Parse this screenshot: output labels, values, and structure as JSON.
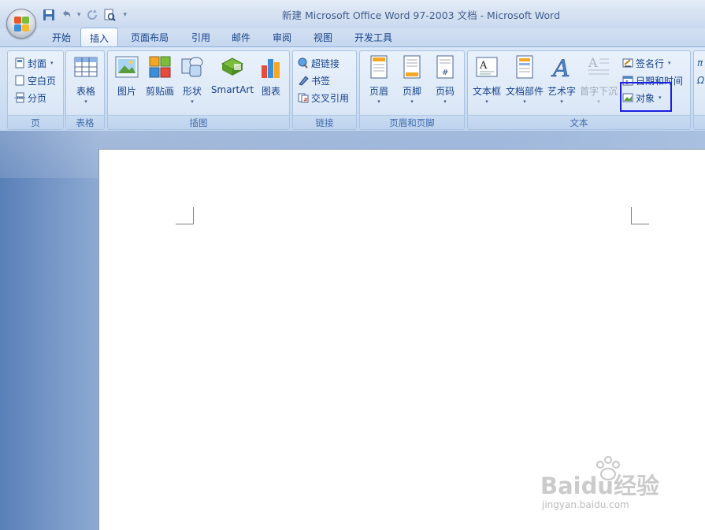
{
  "window": {
    "title": "新建 Microsoft Office Word 97-2003 文档 - Microsoft Word"
  },
  "quick_access": {
    "icons": [
      "save-icon",
      "undo-icon",
      "redo-icon",
      "print-preview-icon",
      "customize-qat-icon"
    ]
  },
  "tabs": [
    {
      "label": "开始",
      "active": false
    },
    {
      "label": "插入",
      "active": true
    },
    {
      "label": "页面布局",
      "active": false
    },
    {
      "label": "引用",
      "active": false
    },
    {
      "label": "邮件",
      "active": false
    },
    {
      "label": "审阅",
      "active": false
    },
    {
      "label": "视图",
      "active": false
    },
    {
      "label": "开发工具",
      "active": false
    }
  ],
  "ribbon": {
    "pages": {
      "label": "页",
      "cover": "封面",
      "blank": "空白页",
      "break": "分页"
    },
    "tables": {
      "label": "表格",
      "table": "表格"
    },
    "illustrations": {
      "label": "插图",
      "picture": "图片",
      "clipart": "剪贴画",
      "shapes": "形状",
      "smartart": "SmartArt",
      "chart": "图表"
    },
    "links": {
      "label": "链接",
      "hyperlink": "超链接",
      "bookmark": "书签",
      "crossref": "交叉引用"
    },
    "header_footer": {
      "label": "页眉和页脚",
      "header": "页眉",
      "footer": "页脚",
      "page_number": "页码"
    },
    "text": {
      "label": "文本",
      "textbox": "文本框",
      "quickparts": "文档部件",
      "wordart": "艺术字",
      "dropcap": "首字下沉",
      "signature": "签名行",
      "datetime": "日期和时间",
      "object": "对象"
    }
  },
  "watermark": {
    "brand": "Baidu经验",
    "url": "jingyan.baidu.com"
  },
  "colors": {
    "highlight": "#1a1ee0",
    "accent": "#15428b"
  }
}
